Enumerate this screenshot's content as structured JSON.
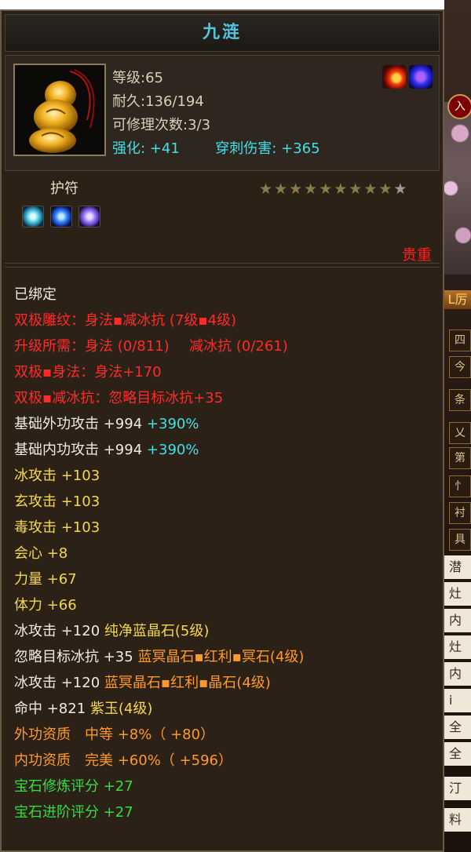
{
  "item": {
    "name": "九涟",
    "stats": {
      "level": "等级:65",
      "durability": "耐久:136/194",
      "repairs": "可修理次数:3/3",
      "enhance_label": "强化:",
      "enhance_value": "+41",
      "pierce_label": "穿刺伤害:",
      "pierce_value": "+365"
    },
    "type": "护符",
    "stars": {
      "filled": 9,
      "total": 10
    },
    "rarity": "贵重",
    "icons": [
      "fire-badge-icon",
      "blue-swirl-badge-icon",
      "amulet-icon",
      "cyan-gem-icon",
      "blue-gem-icon",
      "violet-gem-icon"
    ]
  },
  "attributes": {
    "bound": "已绑定",
    "l1": "双极雕纹：身法▪减冰抗 (7级▪4级)",
    "l2a": "升级所需：身法 (0/811)",
    "l2b": "减冰抗 (0/261)",
    "l3": "双极▪身法：身法+170",
    "l4": "双极▪减冰抗：忽略目标冰抗+35",
    "l5a": "基础外功攻击 +994",
    "l5b": "+390%",
    "l6a": "基础内功攻击 +994",
    "l6b": "+390%",
    "l7": "冰攻击 +103",
    "l8": "玄攻击 +103",
    "l9": "毒攻击 +103",
    "l10": "会心 +8",
    "l11": "力量 +67",
    "l12": "体力 +66",
    "l13a": "冰攻击 +120",
    "l13b": "纯净蓝晶石(5级)",
    "l14a": "忽略目标冰抗 +35",
    "l14b": "蓝冥晶石▪红利▪冥石(4级)",
    "l15a": "冰攻击 +120",
    "l15b": "蓝冥晶石▪红利▪晶石(4级)",
    "l16a": "命中 +821",
    "l16b": "紫玉(4级)",
    "l17": "外功资质　中等 +8%（ +80）",
    "l18": "内功资质　完美 +60%（ +596）",
    "l19": "宝石修炼评分 +27",
    "l20": "宝石进阶评分 +27"
  },
  "background": {
    "redbtn": "入",
    "gold": "L厉",
    "tabs": [
      "四",
      "今",
      "条",
      "乂",
      "第",
      "忄",
      "衬",
      "具"
    ],
    "lightrows": [
      "潜",
      "灶",
      "内",
      "灶",
      "内",
      "i",
      "全",
      "全",
      "汀",
      "料"
    ]
  },
  "colors": {
    "title": "#55c4e0",
    "bound": "#f0ece0",
    "set": "#ff2a2a",
    "base": "#f0ece0",
    "percent": "#3fe0e8",
    "attr": "#f6d84a",
    "gem": "#ff9a28",
    "gem_score": "#30e040",
    "rarity": "#ff2020"
  }
}
